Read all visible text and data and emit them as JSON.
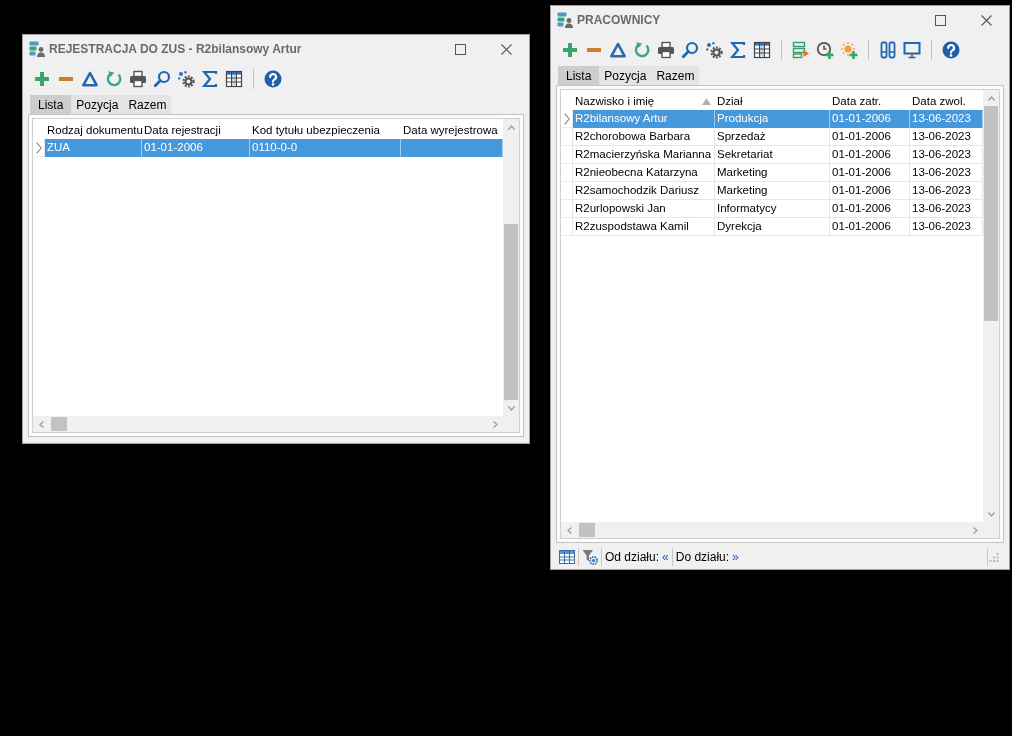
{
  "windows": [
    {
      "kind": "registration",
      "title": "REJESTRACJA DO ZUS - R2bilansowy Artur",
      "tabs": [
        {
          "label": "Lista",
          "selected": true
        },
        {
          "label": "Pozycja",
          "selected": false
        },
        {
          "label": "Razem",
          "selected": false
        }
      ],
      "grid": {
        "columns": [
          {
            "label": "Rodzaj dokumentu",
            "sorted": false
          },
          {
            "label": "Data rejestracji",
            "sorted": false
          },
          {
            "label": "Kod tytułu ubezpieczenia",
            "sorted": false
          },
          {
            "label": "Data wyrejestrowa",
            "sorted": false
          }
        ],
        "rows": [
          {
            "cells": [
              "ZUA",
              "01-01-2006",
              "0110-0-0"
            ],
            "selected": true
          }
        ]
      }
    },
    {
      "kind": "employees",
      "title": "PRACOWNICY",
      "tabs": [
        {
          "label": "Lista",
          "selected": true
        },
        {
          "label": "Pozycja",
          "selected": false
        },
        {
          "label": "Razem",
          "selected": false
        }
      ],
      "grid": {
        "columns": [
          {
            "label": "Nazwisko i imię",
            "sorted": true
          },
          {
            "label": "Dział",
            "sorted": false
          },
          {
            "label": "Data zatr.",
            "sorted": false
          },
          {
            "label": "Data zwol.",
            "sorted": false
          }
        ],
        "rows": [
          {
            "cells": [
              "R2bilansowy Artur",
              "Produkcja",
              "01-01-2006",
              "13-06-2023"
            ],
            "selected": true
          },
          {
            "cells": [
              "R2chorobowa Barbara",
              "Sprzedaż",
              "01-01-2006",
              "13-06-2023"
            ],
            "selected": false
          },
          {
            "cells": [
              "R2macierzyńska Marianna",
              "Sekretariat",
              "01-01-2006",
              "13-06-2023"
            ],
            "selected": false
          },
          {
            "cells": [
              "R2nieobecna Katarzyna",
              "Marketing",
              "01-01-2006",
              "13-06-2023"
            ],
            "selected": false
          },
          {
            "cells": [
              "R2samochodzik Dariusz",
              "Marketing",
              "01-01-2006",
              "13-06-2023"
            ],
            "selected": false
          },
          {
            "cells": [
              "R2urlopowski Jan",
              "Informatycy",
              "01-01-2006",
              "13-06-2023"
            ],
            "selected": false
          },
          {
            "cells": [
              "R2zuspodstawa Kamil",
              "Dyrekcja",
              "01-01-2006",
              "13-06-2023"
            ],
            "selected": false
          }
        ]
      },
      "status_bar": {
        "filters": [
          {
            "label": "Od działu:",
            "value": "«"
          },
          {
            "label": "Do działu:",
            "value": "»"
          }
        ]
      }
    }
  ]
}
